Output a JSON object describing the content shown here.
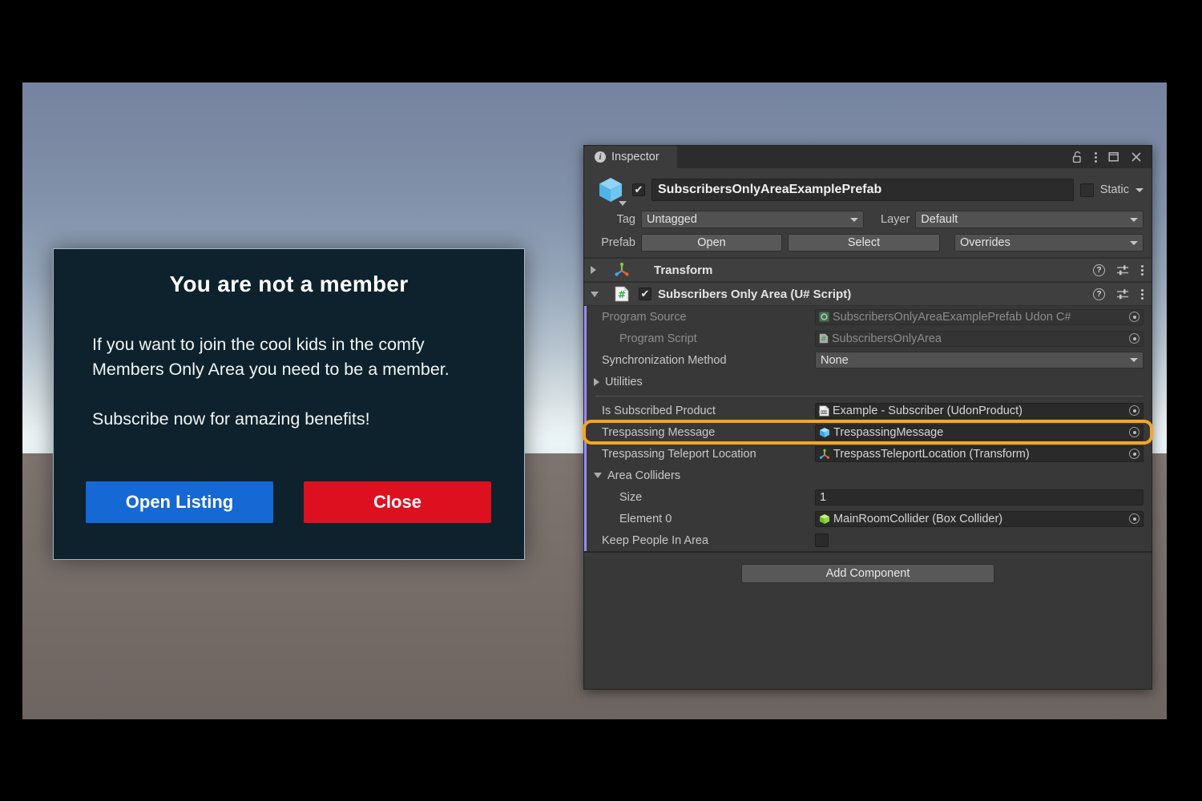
{
  "scene_dialog": {
    "title": "You are not a member",
    "body": "If you want to join the cool kids in the comfy Members Only Area you need to be a member.\n\nSubscribe now for amazing benefits!",
    "open_listing_label": "Open Listing",
    "close_label": "Close",
    "colors": {
      "panel": "#0d222c",
      "open_listing": "#1668d4",
      "close": "#dd1020"
    }
  },
  "inspector": {
    "tab_label": "Inspector",
    "window_icons": [
      "lock-open-icon",
      "kebab-menu-icon",
      "maximize-icon",
      "close-icon"
    ],
    "object": {
      "enabled": true,
      "name": "SubscribersOnlyAreaExamplePrefab",
      "static_label": "Static",
      "static_checked": false,
      "tag_label": "Tag",
      "tag_value": "Untagged",
      "layer_label": "Layer",
      "layer_value": "Default",
      "prefab_label": "Prefab",
      "prefab_open": "Open",
      "prefab_select": "Select",
      "prefab_overrides": "Overrides"
    },
    "components": [
      {
        "name": "transform-component",
        "title": "Transform",
        "icon": "transform-gizmo-icon",
        "expanded": false,
        "has_enable_checkbox": false
      },
      {
        "name": "subscribers-only-area-component",
        "title": "Subscribers Only Area (U# Script)",
        "icon": "udon-sharp-script-icon",
        "expanded": true,
        "has_enable_checkbox": true,
        "enabled": true,
        "properties": [
          {
            "name": "program-source",
            "label": "Program Source",
            "type": "object",
            "value": "SubscribersOnlyAreaExamplePrefab Udon C#",
            "icon": "udon-program-icon",
            "disabled": true,
            "indent": 0
          },
          {
            "name": "program-script",
            "label": "Program Script",
            "type": "object",
            "value": "SubscribersOnlyArea",
            "icon": "udon-sharp-script-icon",
            "disabled": true,
            "indent": 1
          },
          {
            "name": "synchronization-method",
            "label": "Synchronization Method",
            "type": "enum",
            "value": "None",
            "indent": 0
          },
          {
            "name": "utilities",
            "label": "Utilities",
            "type": "foldout",
            "expanded": false,
            "indent": 0
          },
          {
            "name": "separator",
            "type": "separator"
          },
          {
            "name": "is-subscribed-product",
            "label": "Is Subscribed Product",
            "type": "object",
            "value": "Example - Subscriber (UdonProduct)",
            "icon": "udon-product-icon",
            "indent": 0
          },
          {
            "name": "trespassing-message",
            "label": "Trespassing Message",
            "type": "object",
            "value": "TrespassingMessage",
            "icon": "gameobject-cube-icon",
            "indent": 0,
            "highlighted": true
          },
          {
            "name": "trespassing-teleport-location",
            "label": "Trespassing Teleport Location",
            "type": "object",
            "value": "TrespassTeleportLocation (Transform)",
            "icon": "transform-gizmo-icon",
            "indent": 0
          },
          {
            "name": "area-colliders",
            "label": "Area Colliders",
            "type": "foldout",
            "expanded": true,
            "indent": 0
          },
          {
            "name": "area-colliders-size",
            "label": "Size",
            "type": "number",
            "value": "1",
            "indent": 1
          },
          {
            "name": "area-colliders-element-0",
            "label": "Element 0",
            "type": "object",
            "value": "MainRoomCollider (Box Collider)",
            "icon": "collider-cube-icon",
            "indent": 1
          },
          {
            "name": "keep-people-in-area",
            "label": "Keep People In Area",
            "type": "checkbox",
            "checked": false,
            "indent": 0
          }
        ]
      }
    ],
    "add_component_label": "Add Component",
    "highlight_color": "#f5a623"
  }
}
